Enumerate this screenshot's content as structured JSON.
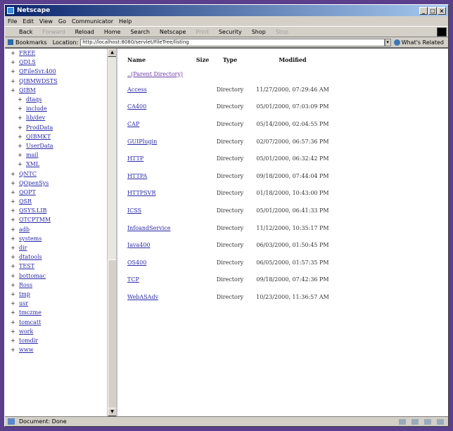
{
  "window": {
    "title": "Netscape"
  },
  "menu": [
    "File",
    "Edit",
    "View",
    "Go",
    "Communicator",
    "Help"
  ],
  "toolbar": [
    {
      "label": "Back",
      "enabled": true
    },
    {
      "label": "Forward",
      "enabled": false
    },
    {
      "label": "Reload",
      "enabled": true
    },
    {
      "label": "Home",
      "enabled": true
    },
    {
      "label": "Search",
      "enabled": true
    },
    {
      "label": "Netscape",
      "enabled": true
    },
    {
      "label": "Print",
      "enabled": false
    },
    {
      "label": "Security",
      "enabled": true
    },
    {
      "label": "Shop",
      "enabled": true
    },
    {
      "label": "Stop",
      "enabled": false
    }
  ],
  "location": {
    "bookmarks_label": "Bookmarks",
    "location_label": "Location:",
    "url": "http://localhost:8080/servlet/FileTree/listing",
    "related_label": "What's Related"
  },
  "tree": [
    {
      "label": "FREE",
      "child": false
    },
    {
      "label": "QDLS",
      "child": false
    },
    {
      "label": "QFileSvr.400",
      "child": false
    },
    {
      "label": "QIBMWDSTS",
      "child": false
    },
    {
      "label": "QIBM",
      "child": false
    },
    {
      "label": "dtaqs",
      "child": true
    },
    {
      "label": "include",
      "child": true
    },
    {
      "label": "lib/dev",
      "child": true
    },
    {
      "label": "ProdData",
      "child": true
    },
    {
      "label": "QIBMKT",
      "child": true
    },
    {
      "label": "UserData",
      "child": true
    },
    {
      "label": "mail",
      "child": true
    },
    {
      "label": "XML",
      "child": true
    },
    {
      "label": "QNTC",
      "child": false
    },
    {
      "label": "QOpenSys",
      "child": false
    },
    {
      "label": "QOPT",
      "child": false
    },
    {
      "label": "QSR",
      "child": false
    },
    {
      "label": "QSYS.LIB",
      "child": false
    },
    {
      "label": "QTCPTMM",
      "child": false
    },
    {
      "label": "adb",
      "child": false
    },
    {
      "label": "systems",
      "child": false
    },
    {
      "label": "dir",
      "child": false
    },
    {
      "label": "dtatools",
      "child": false
    },
    {
      "label": "TEST",
      "child": false
    },
    {
      "label": "bottomac",
      "child": false
    },
    {
      "label": "Ross",
      "child": false
    },
    {
      "label": "tmp",
      "child": false
    },
    {
      "label": "usr",
      "child": false
    },
    {
      "label": "tmczme",
      "child": false
    },
    {
      "label": "tomcatt",
      "child": false
    },
    {
      "label": "work",
      "child": false
    },
    {
      "label": "tomdir",
      "child": false
    },
    {
      "label": "www",
      "child": false
    }
  ],
  "listing": {
    "headers": [
      "Name",
      "Size",
      "Type",
      "Modified"
    ],
    "parent_link": "..(Parent Directory)",
    "rows": [
      {
        "name": "Access",
        "size": "",
        "type": "Directory",
        "modified": "11/27/2000, 07:29:46 AM"
      },
      {
        "name": "CA400",
        "size": "",
        "type": "Directory",
        "modified": "05/01/2000, 07:03:09 PM"
      },
      {
        "name": "CAP",
        "size": "",
        "type": "Directory",
        "modified": "05/14/2000, 02:04:55 PM"
      },
      {
        "name": "GUIPlugin",
        "size": "",
        "type": "Directory",
        "modified": "02/07/2000, 06:57:36 PM"
      },
      {
        "name": "HTTP",
        "size": "",
        "type": "Directory",
        "modified": "05/01/2000, 06:32:42 PM"
      },
      {
        "name": "HTTPA",
        "size": "",
        "type": "Directory",
        "modified": "09/18/2000, 07:44:04 PM"
      },
      {
        "name": "HTTPSVR",
        "size": "",
        "type": "Directory",
        "modified": "01/18/2000, 10:43:00 PM"
      },
      {
        "name": "ICSS",
        "size": "",
        "type": "Directory",
        "modified": "05/01/2000, 06:41:33 PM"
      },
      {
        "name": "InfoandService",
        "size": "",
        "type": "Directory",
        "modified": "11/12/2000, 10:35:17 PM"
      },
      {
        "name": "Java400",
        "size": "",
        "type": "Directory",
        "modified": "06/03/2000, 01:50:45 PM"
      },
      {
        "name": "OS400",
        "size": "",
        "type": "Directory",
        "modified": "06/05/2000, 01:57:35 PM"
      },
      {
        "name": "TCP",
        "size": "",
        "type": "Directory",
        "modified": "09/18/2000, 07:42:36 PM"
      },
      {
        "name": "WebASAdv",
        "size": "",
        "type": "Directory",
        "modified": "10/23/2000, 11:36:57 AM"
      }
    ]
  },
  "status": {
    "text": "Document: Done"
  }
}
